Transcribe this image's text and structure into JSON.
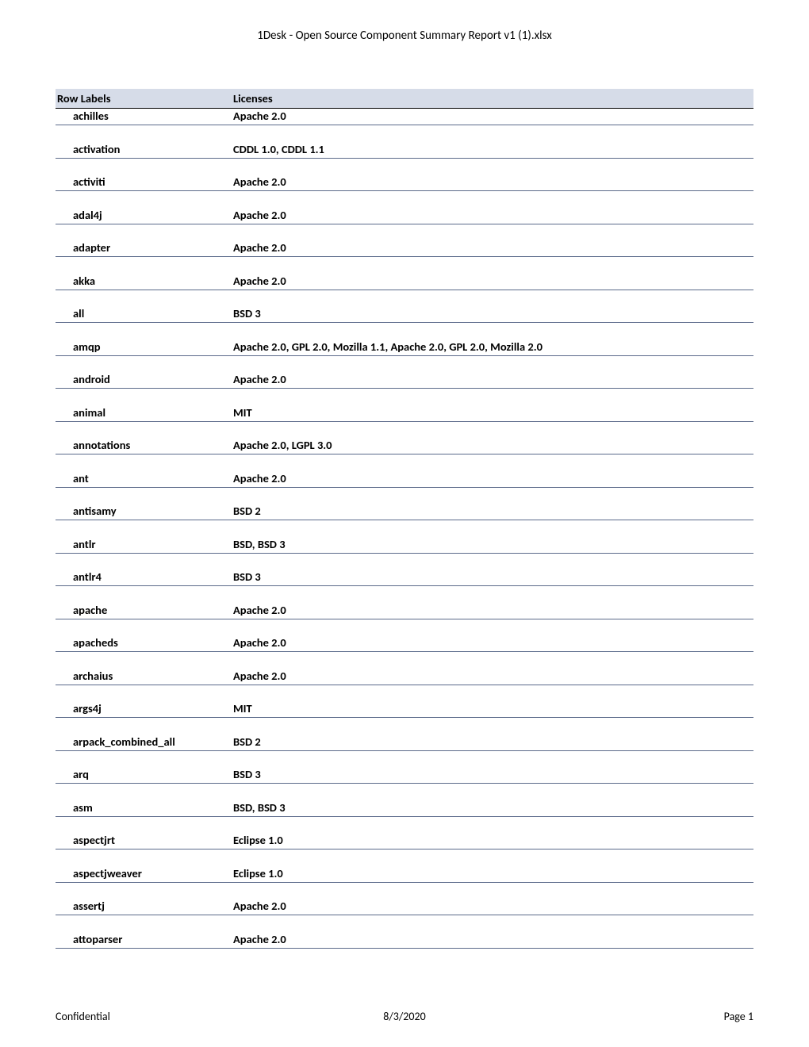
{
  "doc_title": "1Desk - Open Source Component Summary Report v1 (1).xlsx",
  "headers": {
    "col1": "Row Labels",
    "col2": "Licenses"
  },
  "rows": [
    {
      "label": "achilles",
      "license": "Apache 2.0"
    },
    {
      "label": "activation",
      "license": "CDDL 1.0, CDDL 1.1"
    },
    {
      "label": "activiti",
      "license": "Apache 2.0"
    },
    {
      "label": "adal4j",
      "license": "Apache 2.0"
    },
    {
      "label": "adapter",
      "license": "Apache 2.0"
    },
    {
      "label": "akka",
      "license": "Apache 2.0"
    },
    {
      "label": "all",
      "license": "BSD 3"
    },
    {
      "label": "amqp",
      "license": "Apache 2.0, GPL 2.0, Mozilla 1.1, Apache 2.0, GPL 2.0, Mozilla 2.0"
    },
    {
      "label": "android",
      "license": "Apache 2.0"
    },
    {
      "label": "animal",
      "license": "MIT"
    },
    {
      "label": "annotations",
      "license": "Apache 2.0, LGPL 3.0"
    },
    {
      "label": "ant",
      "license": "Apache 2.0"
    },
    {
      "label": "antisamy",
      "license": "BSD 2"
    },
    {
      "label": "antlr",
      "license": "BSD, BSD 3"
    },
    {
      "label": "antlr4",
      "license": "BSD 3"
    },
    {
      "label": "apache",
      "license": "Apache 2.0"
    },
    {
      "label": "apacheds",
      "license": "Apache 2.0"
    },
    {
      "label": "archaius",
      "license": "Apache 2.0"
    },
    {
      "label": "args4j",
      "license": "MIT"
    },
    {
      "label": "arpack_combined_all",
      "license": "BSD 2"
    },
    {
      "label": "arq",
      "license": "BSD 3"
    },
    {
      "label": "asm",
      "license": "BSD, BSD 3"
    },
    {
      "label": "aspectjrt",
      "license": "Eclipse 1.0"
    },
    {
      "label": "aspectjweaver",
      "license": "Eclipse 1.0"
    },
    {
      "label": "assertj",
      "license": "Apache 2.0"
    },
    {
      "label": "attoparser",
      "license": "Apache 2.0"
    }
  ],
  "footer": {
    "left": "Confidential",
    "center": "8/3/2020",
    "right": "Page 1"
  }
}
